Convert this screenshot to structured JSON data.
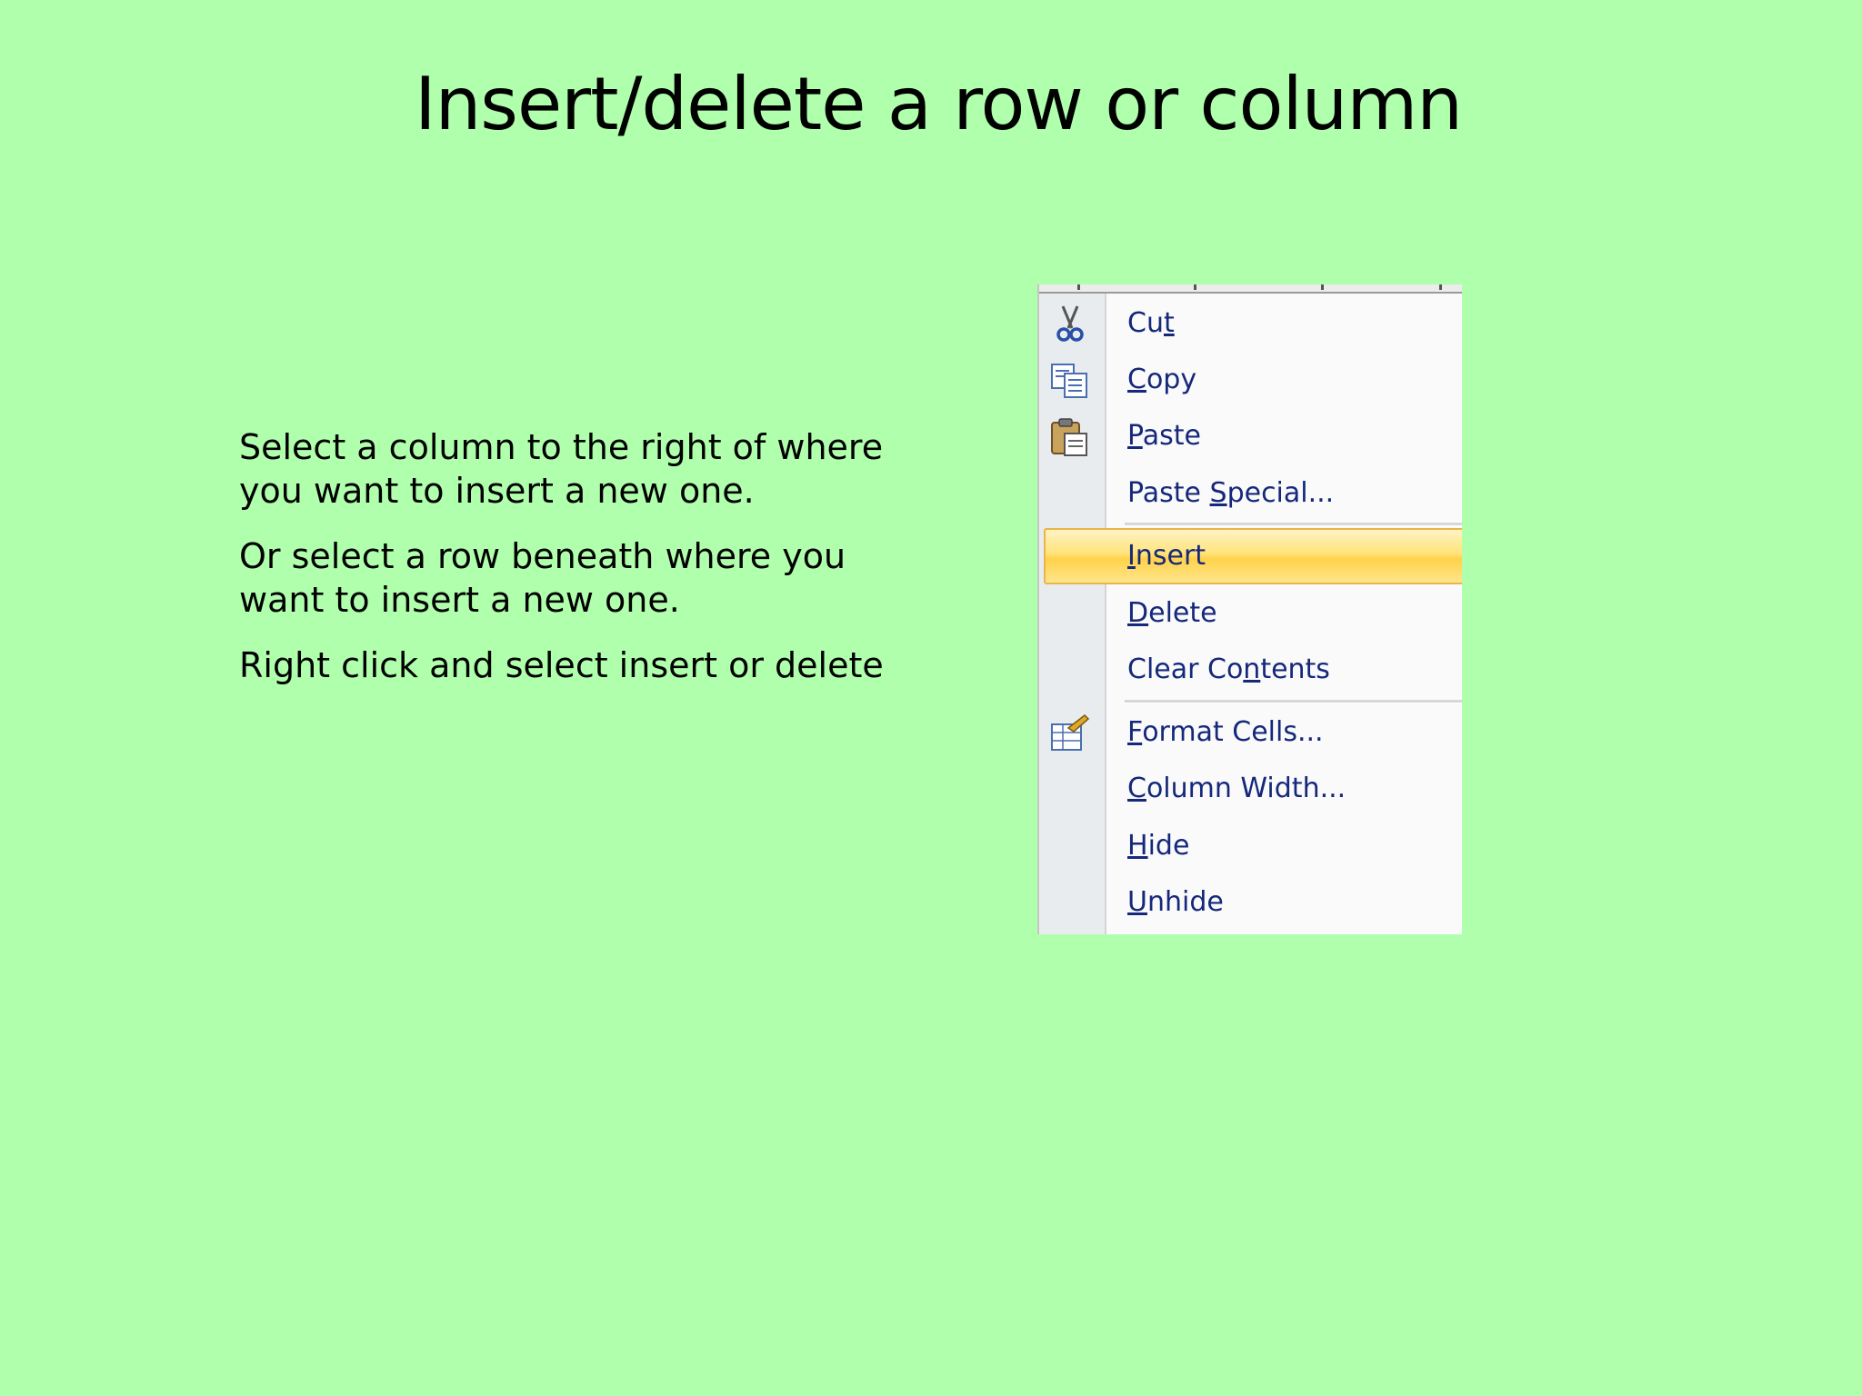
{
  "slide": {
    "title": "Insert/delete a row or column",
    "paragraphs": [
      "Select a column to the right of where you want to insert a new one.",
      "Or select a row beneath where you want to insert a new one.",
      "Right click and select insert or delete"
    ]
  },
  "context_menu": {
    "highlighted_item": "Insert",
    "items": [
      {
        "label": "Cut",
        "access_key": "t",
        "icon": "scissors-icon"
      },
      {
        "label": "Copy",
        "access_key": "C",
        "icon": "copy-icon"
      },
      {
        "label": "Paste",
        "access_key": "P",
        "icon": "paste-icon"
      },
      {
        "label": "Paste Special...",
        "access_key": "S",
        "icon": ""
      },
      {
        "label": "Insert",
        "access_key": "I",
        "icon": ""
      },
      {
        "label": "Delete",
        "access_key": "D",
        "icon": ""
      },
      {
        "label": "Clear Contents",
        "access_key": "n",
        "icon": ""
      },
      {
        "label": "Format Cells...",
        "access_key": "F",
        "icon": "format-cells-icon"
      },
      {
        "label": "Column Width...",
        "access_key": "C",
        "icon": ""
      },
      {
        "label": "Hide",
        "access_key": "H",
        "icon": ""
      },
      {
        "label": "Unhide",
        "access_key": "U",
        "icon": ""
      }
    ]
  },
  "colors": {
    "background": "#b0ffac",
    "menu_text": "#15287a",
    "highlight": "#ffd24a"
  }
}
